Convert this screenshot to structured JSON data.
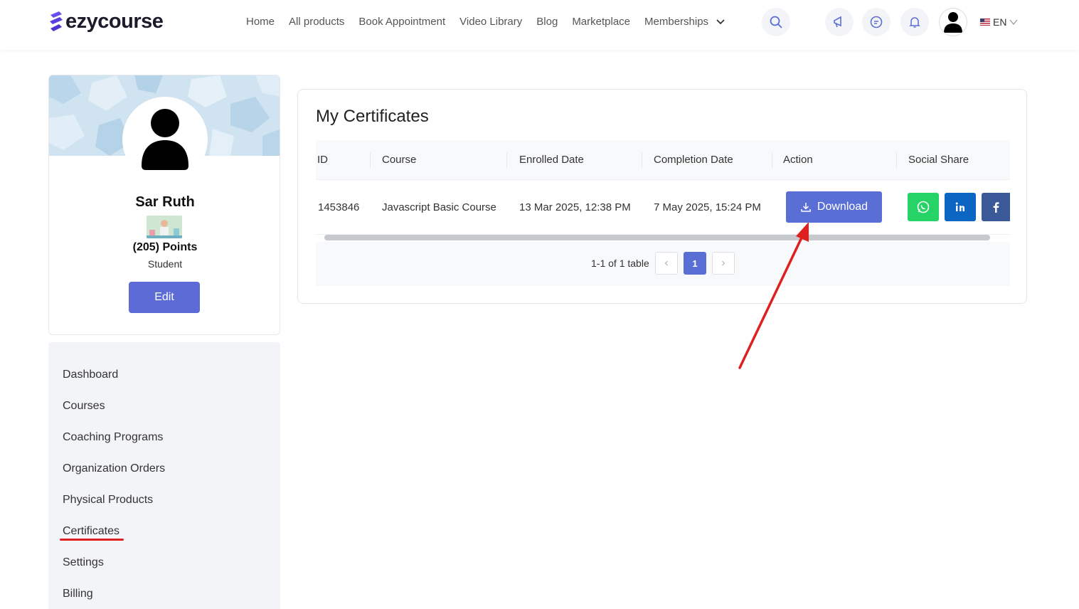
{
  "brand": {
    "name": "ezycourse"
  },
  "nav": {
    "items": [
      "Home",
      "All products",
      "Book Appointment",
      "Video Library",
      "Blog",
      "Marketplace",
      "Memberships"
    ]
  },
  "lang": {
    "code": "EN"
  },
  "profile": {
    "name": "Sar Ruth",
    "points": "(205) Points",
    "role": "Student",
    "edit_label": "Edit"
  },
  "sidebar": {
    "items": [
      "Dashboard",
      "Courses",
      "Coaching Programs",
      "Organization Orders",
      "Physical Products",
      "Certificates",
      "Settings",
      "Billing"
    ],
    "active": "Certificates"
  },
  "certificates": {
    "title": "My Certificates",
    "columns": [
      "ID",
      "Course",
      "Enrolled Date",
      "Completion Date",
      "Action",
      "Social Share"
    ],
    "rows": [
      {
        "id": "1453846",
        "course": "Javascript Basic Course",
        "enrolled": "13 Mar 2025, 12:38 PM",
        "completed": "7 May 2025, 15:24 PM",
        "action_label": "Download"
      }
    ],
    "share_icons": [
      "whatsapp-icon",
      "linkedin-icon",
      "facebook-icon"
    ],
    "share_colors": {
      "whatsapp": "#25d366",
      "linkedin": "#0a66c2",
      "facebook": "#3b5998"
    },
    "pagination": {
      "summary": "1-1 of 1 table",
      "current_page": "1"
    }
  },
  "colors": {
    "accent": "#5a6fd6",
    "annotation": "#e02020"
  }
}
